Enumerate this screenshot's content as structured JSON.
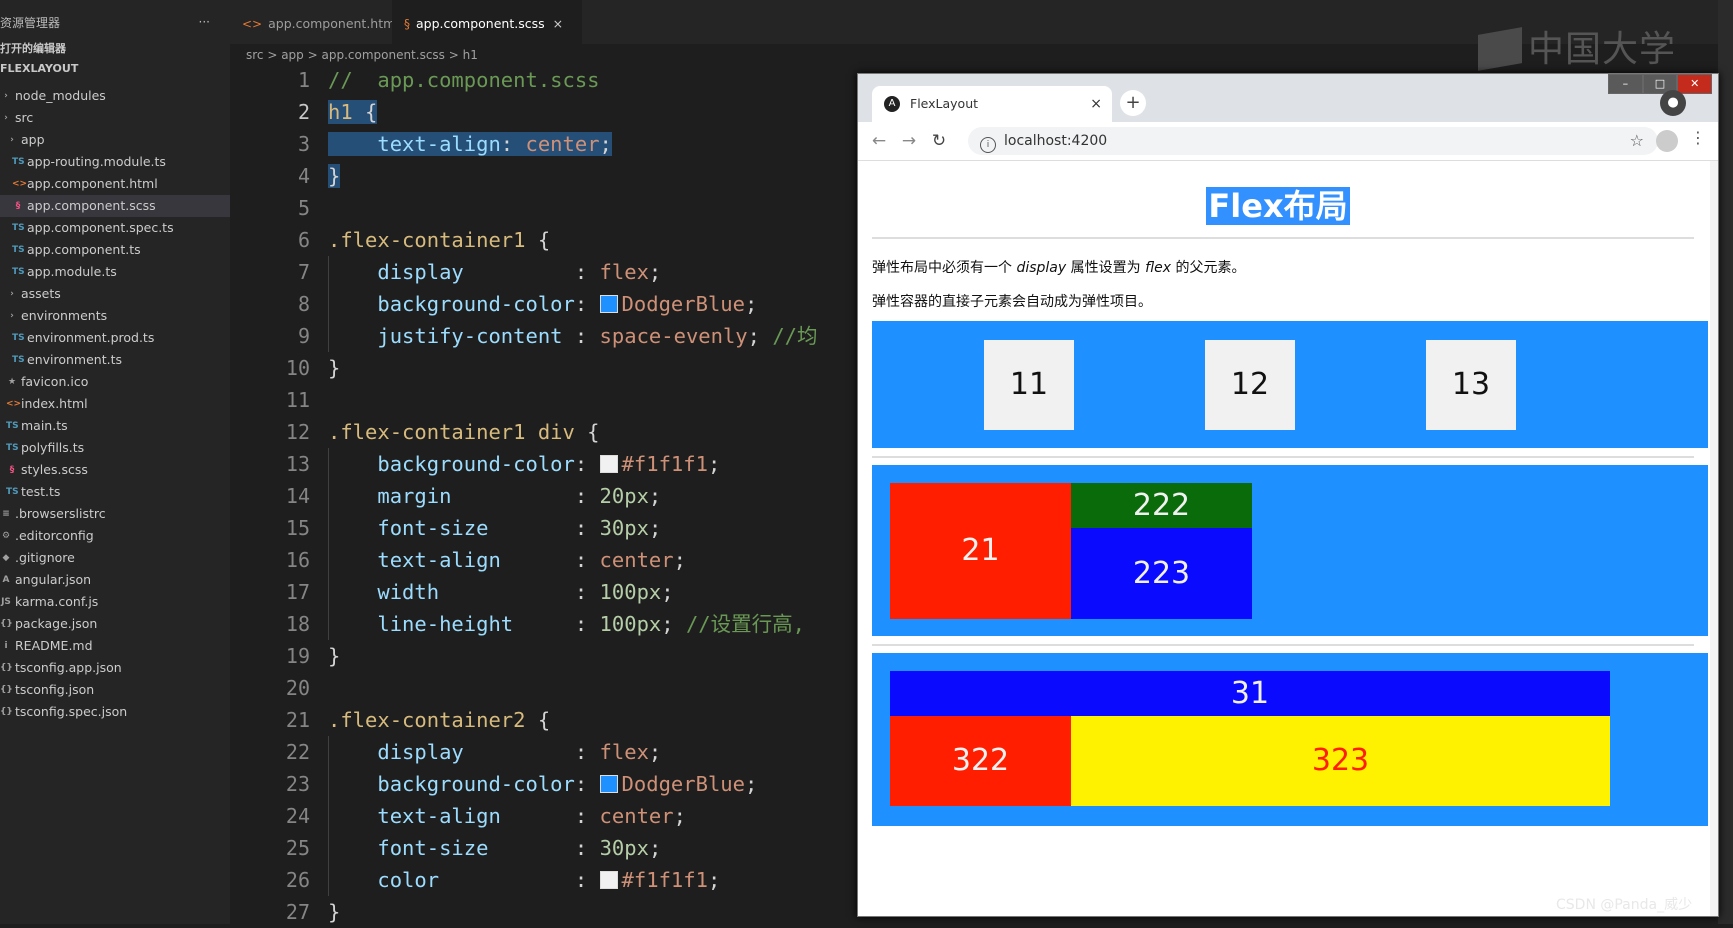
{
  "sidebar": {
    "header": "资源管理器",
    "more": "···",
    "open_editors": "打开的编辑器",
    "project": "FLEXLAYOUT",
    "items": [
      {
        "label": "node_modules",
        "icon": "folder-icon",
        "indent": 0
      },
      {
        "label": "src",
        "icon": "folder-icon",
        "indent": 0
      },
      {
        "label": "app",
        "icon": "folder-icon",
        "indent": 1
      },
      {
        "label": "app-routing.module.ts",
        "icon": "TS",
        "indent": 2
      },
      {
        "label": "app.component.html",
        "icon": "<>",
        "indent": 2
      },
      {
        "label": "app.component.scss",
        "icon": "§",
        "indent": 2,
        "active": true
      },
      {
        "label": "app.component.spec.ts",
        "icon": "TS",
        "indent": 2
      },
      {
        "label": "app.component.ts",
        "icon": "TS",
        "indent": 2
      },
      {
        "label": "app.module.ts",
        "icon": "TS",
        "indent": 2
      },
      {
        "label": "assets",
        "icon": "folder-icon",
        "indent": 1
      },
      {
        "label": "environments",
        "icon": "folder-icon",
        "indent": 1
      },
      {
        "label": "environment.prod.ts",
        "icon": "TS",
        "indent": 2
      },
      {
        "label": "environment.ts",
        "icon": "TS",
        "indent": 2
      },
      {
        "label": "favicon.ico",
        "icon": "★",
        "indent": 1
      },
      {
        "label": "index.html",
        "icon": "<>",
        "indent": 1
      },
      {
        "label": "main.ts",
        "icon": "TS",
        "indent": 1
      },
      {
        "label": "polyfills.ts",
        "icon": "TS",
        "indent": 1
      },
      {
        "label": "styles.scss",
        "icon": "§",
        "indent": 1
      },
      {
        "label": "test.ts",
        "icon": "TS",
        "indent": 1
      },
      {
        "label": ".browserslistrc",
        "icon": "≡",
        "indent": 0
      },
      {
        "label": ".editorconfig",
        "icon": "⚙",
        "indent": 0
      },
      {
        "label": ".gitignore",
        "icon": "◆",
        "indent": 0
      },
      {
        "label": "angular.json",
        "icon": "A",
        "indent": 0
      },
      {
        "label": "karma.conf.js",
        "icon": "JS",
        "indent": 0
      },
      {
        "label": "package.json",
        "icon": "{}",
        "indent": 0
      },
      {
        "label": "README.md",
        "icon": "i",
        "indent": 0
      },
      {
        "label": "tsconfig.app.json",
        "icon": "{}",
        "indent": 0
      },
      {
        "label": "tsconfig.json",
        "icon": "{}",
        "indent": 0
      },
      {
        "label": "tsconfig.spec.json",
        "icon": "{}",
        "indent": 0
      }
    ]
  },
  "editor": {
    "tabs": [
      {
        "label": "app.component.html",
        "active": false
      },
      {
        "label": "app.component.scss",
        "active": true,
        "close": "×"
      }
    ],
    "breadcrumb": "src > app > app.component.scss > h1",
    "current_line": 2,
    "lines": [
      [
        [
          "c-com",
          "//  app.component.scss"
        ]
      ],
      [
        [
          "c-sel",
          "h1"
        ],
        [
          "c-pun",
          " {"
        ]
      ],
      [
        [
          "c-pun",
          "    "
        ],
        [
          "c-prop",
          "text-align"
        ],
        [
          "c-pun",
          ": "
        ],
        [
          "c-val",
          "center"
        ],
        [
          "c-pun",
          ";"
        ]
      ],
      [
        [
          "c-pun",
          "}"
        ]
      ],
      [],
      [
        [
          "c-sel",
          ".flex-container1"
        ],
        [
          "c-pun",
          " {"
        ]
      ],
      [
        [
          "c-pun",
          "    "
        ],
        [
          "c-prop",
          "display"
        ],
        [
          "c-pun",
          "         : "
        ],
        [
          "c-val",
          "flex"
        ],
        [
          "c-pun",
          ";"
        ]
      ],
      [
        [
          "c-pun",
          "    "
        ],
        [
          "c-prop",
          "background-color"
        ],
        [
          "c-pun",
          ": "
        ],
        [
          "swatch",
          "#1e90ff"
        ],
        [
          "c-val",
          "DodgerBlue"
        ],
        [
          "c-pun",
          ";"
        ]
      ],
      [
        [
          "c-pun",
          "    "
        ],
        [
          "c-prop",
          "justify-content"
        ],
        [
          "c-pun",
          " : "
        ],
        [
          "c-val",
          "space-evenly"
        ],
        [
          "c-pun",
          "; "
        ],
        [
          "c-com",
          "//均"
        ]
      ],
      [
        [
          "c-pun",
          "}"
        ]
      ],
      [],
      [
        [
          "c-sel",
          ".flex-container1 div"
        ],
        [
          "c-pun",
          " {"
        ]
      ],
      [
        [
          "c-pun",
          "    "
        ],
        [
          "c-prop",
          "background-color"
        ],
        [
          "c-pun",
          ": "
        ],
        [
          "swatch",
          "#f1f1f1"
        ],
        [
          "c-val",
          "#f1f1f1"
        ],
        [
          "c-pun",
          ";"
        ]
      ],
      [
        [
          "c-pun",
          "    "
        ],
        [
          "c-prop",
          "margin"
        ],
        [
          "c-pun",
          "          : "
        ],
        [
          "c-num",
          "20px"
        ],
        [
          "c-pun",
          ";"
        ]
      ],
      [
        [
          "c-pun",
          "    "
        ],
        [
          "c-prop",
          "font-size"
        ],
        [
          "c-pun",
          "       : "
        ],
        [
          "c-num",
          "30px"
        ],
        [
          "c-pun",
          ";"
        ]
      ],
      [
        [
          "c-pun",
          "    "
        ],
        [
          "c-prop",
          "text-align"
        ],
        [
          "c-pun",
          "      : "
        ],
        [
          "c-val",
          "center"
        ],
        [
          "c-pun",
          ";"
        ]
      ],
      [
        [
          "c-pun",
          "    "
        ],
        [
          "c-prop",
          "width"
        ],
        [
          "c-pun",
          "           : "
        ],
        [
          "c-num",
          "100px"
        ],
        [
          "c-pun",
          ";"
        ]
      ],
      [
        [
          "c-pun",
          "    "
        ],
        [
          "c-prop",
          "line-height"
        ],
        [
          "c-pun",
          "     : "
        ],
        [
          "c-num",
          "100px"
        ],
        [
          "c-pun",
          "; "
        ],
        [
          "c-com",
          "//设置行高,"
        ]
      ],
      [
        [
          "c-pun",
          "}"
        ]
      ],
      [],
      [
        [
          "c-sel",
          ".flex-container2"
        ],
        [
          "c-pun",
          " {"
        ]
      ],
      [
        [
          "c-pun",
          "    "
        ],
        [
          "c-prop",
          "display"
        ],
        [
          "c-pun",
          "         : "
        ],
        [
          "c-val",
          "flex"
        ],
        [
          "c-pun",
          ";"
        ]
      ],
      [
        [
          "c-pun",
          "    "
        ],
        [
          "c-prop",
          "background-color"
        ],
        [
          "c-pun",
          ": "
        ],
        [
          "swatch",
          "#1e90ff"
        ],
        [
          "c-val",
          "DodgerBlue"
        ],
        [
          "c-pun",
          ";"
        ]
      ],
      [
        [
          "c-pun",
          "    "
        ],
        [
          "c-prop",
          "text-align"
        ],
        [
          "c-pun",
          "      : "
        ],
        [
          "c-val",
          "center"
        ],
        [
          "c-pun",
          ";"
        ]
      ],
      [
        [
          "c-pun",
          "    "
        ],
        [
          "c-prop",
          "font-size"
        ],
        [
          "c-pun",
          "       : "
        ],
        [
          "c-num",
          "30px"
        ],
        [
          "c-pun",
          ";"
        ]
      ],
      [
        [
          "c-pun",
          "    "
        ],
        [
          "c-prop",
          "color"
        ],
        [
          "c-pun",
          "           : "
        ],
        [
          "swatch",
          "#f1f1f1"
        ],
        [
          "c-val",
          "#f1f1f1"
        ],
        [
          "c-pun",
          ";"
        ]
      ],
      [
        [
          "c-pun",
          "}"
        ]
      ]
    ]
  },
  "browser": {
    "tab_title": "FlexLayout",
    "tab_close": "×",
    "new_tab": "+",
    "url": "localhost:4200",
    "window_controls": [
      "–",
      "□",
      "✕"
    ]
  },
  "page": {
    "h1": "Flex布局",
    "p1_a": "弹性布局中必须有一个 ",
    "p1_b": "display",
    "p1_c": " 属性设置为 ",
    "p1_d": "flex",
    "p1_e": " 的父元素。",
    "p2": "弹性容器的直接子元素会自动成为弹性项目。",
    "row1": [
      "11",
      "12",
      "13"
    ],
    "row2": {
      "left": "21",
      "top": "222",
      "bottom": "223"
    },
    "row3": {
      "top": "31",
      "left": "322",
      "right": "323"
    }
  },
  "watermark": "中国大学MOOC",
  "credit": "CSDN @Panda_威少",
  "colors": {
    "dodgerblue": "#1e90ff",
    "box_gray": "#f1f1f1",
    "red": "#ff1e00",
    "green": "#0a6b0a",
    "blue": "#0a0aff",
    "yellow": "#fff200"
  }
}
